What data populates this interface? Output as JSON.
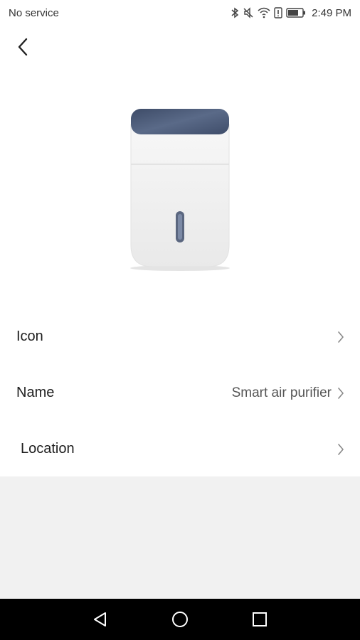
{
  "status_bar": {
    "carrier": "No service",
    "time": "2:49 PM",
    "icons": [
      "bluetooth-icon",
      "mute-icon",
      "wifi-icon",
      "sim-alert-icon",
      "battery-icon"
    ]
  },
  "header": {
    "back_icon": "chevron-left-icon"
  },
  "device": {
    "image": "air-purifier-illustration",
    "colors": {
      "top_panel": "#4a5a78",
      "body": "#f2f2f2",
      "indicator": "#5b6780"
    }
  },
  "settings": {
    "icon_row": {
      "label": "Icon"
    },
    "name_row": {
      "label": "Name",
      "value": "Smart air purifier"
    },
    "location_row": {
      "label": "Location"
    }
  },
  "nav_bar": {
    "buttons": [
      "back-triangle-icon",
      "home-circle-icon",
      "recents-square-icon"
    ]
  }
}
